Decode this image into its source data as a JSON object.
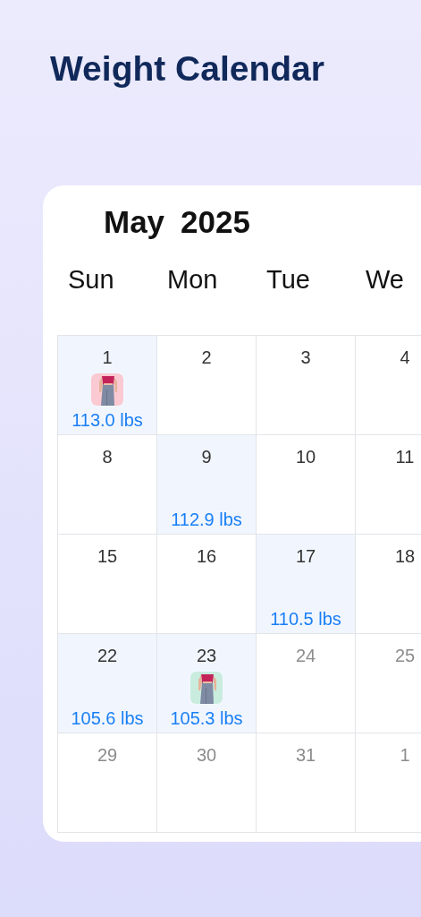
{
  "title": "Weight Calendar",
  "calendar": {
    "month": "May",
    "year": "2025",
    "weekdays": [
      "Sun",
      "Mon",
      "Tue",
      "We"
    ],
    "weeks": [
      [
        {
          "day": "1",
          "logged": true,
          "muted": false,
          "weight": "113.0 lbs"
        },
        {
          "day": "2",
          "logged": false,
          "muted": false
        },
        {
          "day": "3",
          "logged": false,
          "muted": false
        },
        {
          "day": "4",
          "logged": false,
          "muted": false
        }
      ],
      [
        {
          "day": "8",
          "logged": false,
          "muted": false
        },
        {
          "day": "9",
          "logged": true,
          "muted": false,
          "weight": "112.9 lbs"
        },
        {
          "day": "10",
          "logged": false,
          "muted": false
        },
        {
          "day": "11",
          "logged": false,
          "muted": false
        }
      ],
      [
        {
          "day": "15",
          "logged": false,
          "muted": false
        },
        {
          "day": "16",
          "logged": false,
          "muted": false
        },
        {
          "day": "17",
          "logged": true,
          "muted": false,
          "weight": "110.5 lbs"
        },
        {
          "day": "18",
          "logged": false,
          "muted": false
        }
      ],
      [
        {
          "day": "22",
          "logged": true,
          "muted": false,
          "weight": "105.6 lbs"
        },
        {
          "day": "23",
          "logged": true,
          "muted": false,
          "weight": "105.3 lbs"
        },
        {
          "day": "24",
          "logged": false,
          "muted": true
        },
        {
          "day": "25",
          "logged": false,
          "muted": true
        }
      ],
      [
        {
          "day": "29",
          "logged": false,
          "muted": true
        },
        {
          "day": "30",
          "logged": false,
          "muted": true
        },
        {
          "day": "31",
          "logged": false,
          "muted": true
        },
        {
          "day": "1",
          "logged": false,
          "muted": true
        }
      ]
    ]
  }
}
